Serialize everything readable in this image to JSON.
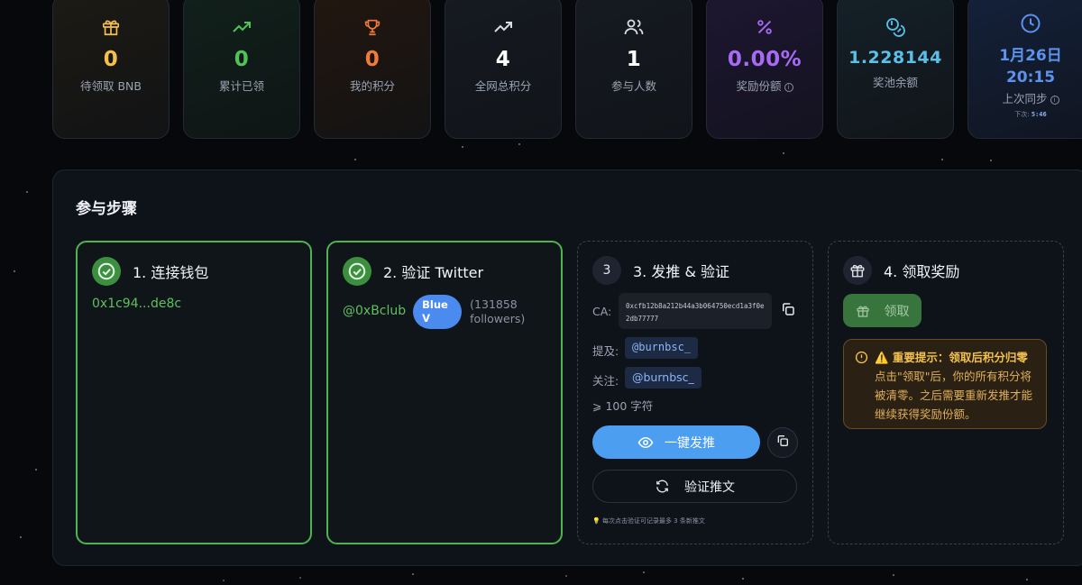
{
  "stats": [
    {
      "icon": "gift-icon",
      "value": "0",
      "label": "待领取 BNB",
      "color": "#f5c04a"
    },
    {
      "icon": "trending-up-icon",
      "value": "0",
      "label": "累计已领",
      "color": "#4fc25a"
    },
    {
      "icon": "trophy-icon",
      "value": "0",
      "label": "我的积分",
      "color": "#f07a3a"
    },
    {
      "icon": "trending-up-icon",
      "value": "4",
      "label": "全网总积分",
      "color": "#ffffff"
    },
    {
      "icon": "users-icon",
      "value": "1",
      "label": "参与人数",
      "color": "#ffffff"
    },
    {
      "icon": "percent-icon",
      "value": "0.00%",
      "label": "奖励份额",
      "color": "#a66af5"
    },
    {
      "icon": "coins-icon",
      "value": "1.228144",
      "label": "奖池余额",
      "color": "#5bc0e8"
    },
    {
      "icon": "clock-icon",
      "value": "1月26日",
      "value2": "20:15",
      "label": "上次同步",
      "sub_prefix": "下次:",
      "sub_value": "5:46",
      "color": "#5b93ee"
    }
  ],
  "panel": {
    "title": "参与步骤",
    "steps": [
      {
        "number": "1",
        "title": "1. 连接钱包",
        "wallet": "0x1c94...de8c"
      },
      {
        "number": "2",
        "title": "2. 验证 Twitter",
        "handle": "@0xBclub",
        "badge": "Blue V",
        "badge_line1": "Blue",
        "badge_line2": "V",
        "followers_line1": "(131858",
        "followers_line2": "followers)"
      },
      {
        "number": "3",
        "title": "3. 发推 & 验证",
        "ca_label": "CA:",
        "ca": "0xcfb12b8a212b44a3b064750ecd1a3f0e2db77777",
        "mention_label": "提及:",
        "mention": "@burnbsc_",
        "follow_label": "关注:",
        "follow": "@burnbsc_",
        "chars": "⩾ 100 字符",
        "tweet_button": "一键发推",
        "verify_button": "验证推文",
        "hint": "💡 每次点击验证可记录最多 3 条新推文"
      },
      {
        "number": "4",
        "title": "4. 领取奖励",
        "claim_button": "领取",
        "warning_title": "⚠️ 重要提示：领取后积分归零",
        "warning_text": "点击\"领取\"后，你的所有积分将被清零。之后需要重新发推才能继续获得奖励份额。"
      }
    ]
  }
}
